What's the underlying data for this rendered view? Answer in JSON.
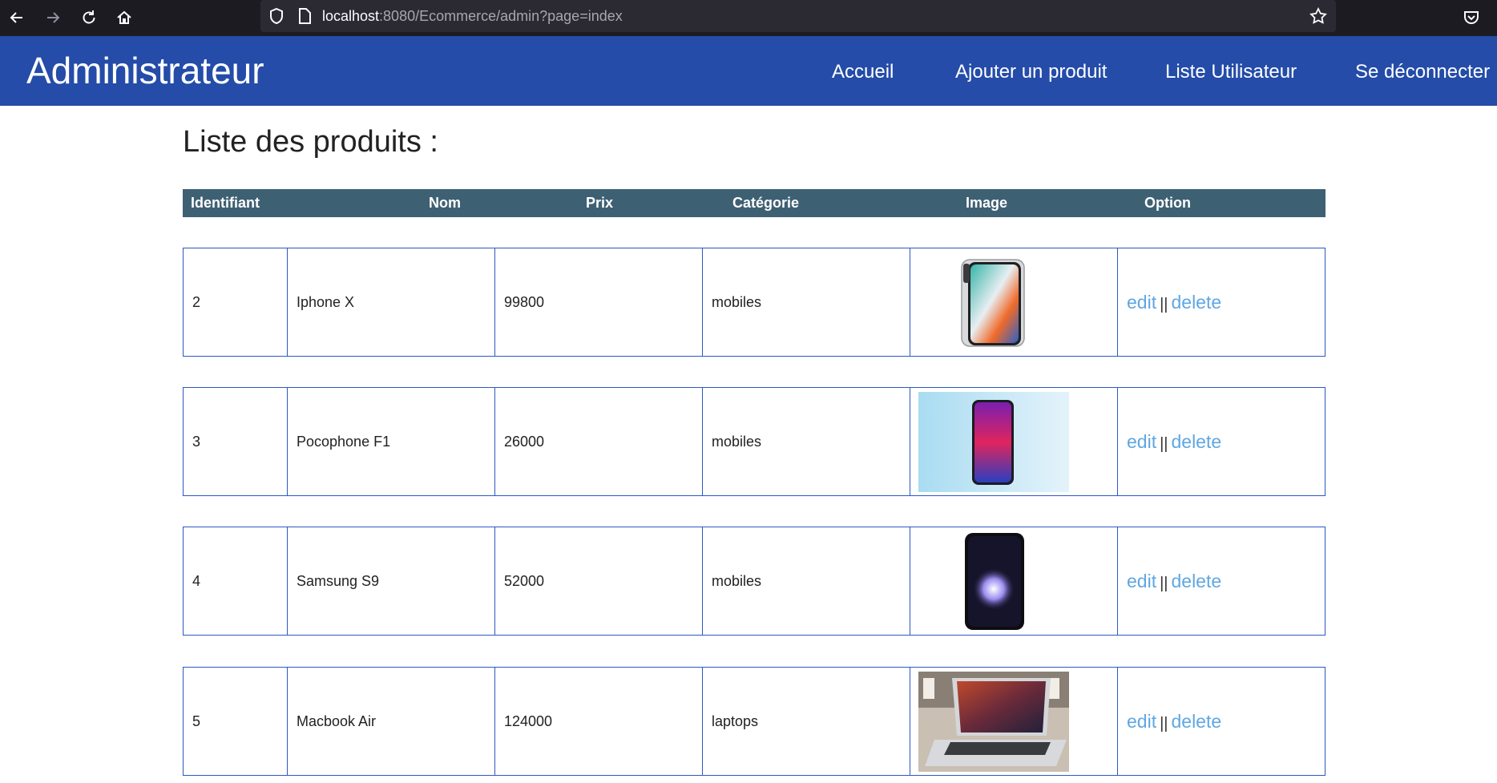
{
  "browser": {
    "url_host": "localhost",
    "url_rest": ":8080/Ecommerce/admin?page=index"
  },
  "navbar": {
    "brand": "Administrateur",
    "links": [
      "Accueil",
      "Ajouter un produit",
      "Liste Utilisateur",
      "Se déconnecter"
    ]
  },
  "main": {
    "title": "Liste des produits :",
    "headers": [
      "Identifiant",
      "Nom",
      "Prix",
      "Catégorie",
      "Image",
      "Option"
    ],
    "edit_label": "edit",
    "separator": "||",
    "delete_label": "delete",
    "products": [
      {
        "id": "2",
        "name": "Iphone X",
        "price": "99800",
        "category": "mobiles",
        "image": "iphone-x"
      },
      {
        "id": "3",
        "name": "Pocophone F1",
        "price": "26000",
        "category": "mobiles",
        "image": "pocophone-f1"
      },
      {
        "id": "4",
        "name": "Samsung S9",
        "price": "52000",
        "category": "mobiles",
        "image": "samsung-s9"
      },
      {
        "id": "5",
        "name": "Macbook Air",
        "price": "124000",
        "category": "laptops",
        "image": "macbook-air"
      }
    ]
  },
  "colors": {
    "navbar": "#244ca8",
    "table_header": "#3e6073",
    "border": "#2d58c4",
    "link": "#5fa7e2"
  }
}
